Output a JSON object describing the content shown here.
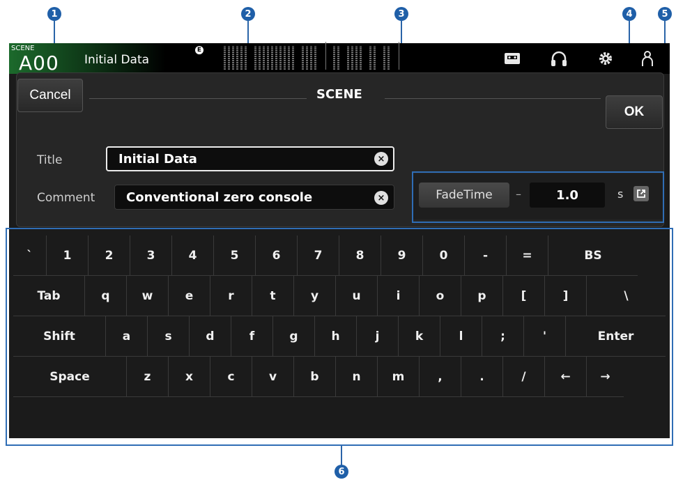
{
  "callouts": [
    "1",
    "2",
    "3",
    "4",
    "5",
    "6"
  ],
  "topbar": {
    "scene_label": "SCENE",
    "scene_number": "A00",
    "scene_name": "Initial Data",
    "badge": "E",
    "icons": [
      "recorder-icon",
      "headphones-icon",
      "gear-icon",
      "user-icon"
    ]
  },
  "dialog": {
    "title": "SCENE",
    "cancel_label": "Cancel",
    "ok_label": "OK",
    "title_label": "Title",
    "title_value": "Initial Data",
    "comment_label": "Comment",
    "comment_value": "Conventional zero console",
    "clear_glyph": "×"
  },
  "fade": {
    "button_label": "FadeTime",
    "dash": "–",
    "value": "1.0",
    "unit": "s"
  },
  "keyboard": {
    "rows": [
      [
        "`",
        "1",
        "2",
        "3",
        "4",
        "5",
        "6",
        "7",
        "8",
        "9",
        "0",
        "-",
        "=",
        "BS"
      ],
      [
        "Tab",
        "q",
        "w",
        "e",
        "r",
        "t",
        "y",
        "u",
        "i",
        "o",
        "p",
        "[",
        "]",
        "\\"
      ],
      [
        "Shift",
        "a",
        "s",
        "d",
        "f",
        "g",
        "h",
        "j",
        "k",
        "l",
        ";",
        "'",
        "Enter"
      ],
      [
        "Space",
        "z",
        "x",
        "c",
        "v",
        "b",
        "n",
        "m",
        ",",
        ".",
        "/",
        "←",
        "→"
      ]
    ]
  },
  "colors": {
    "callout": "#1f5fa8",
    "scene_green": "#1c6a2c",
    "background": "#1b1b1b",
    "highlight": "#2f6db5"
  }
}
